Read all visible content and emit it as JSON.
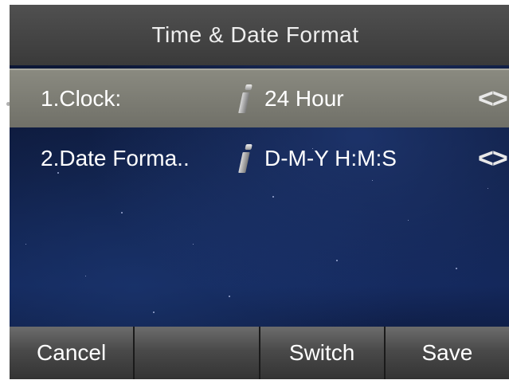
{
  "header": {
    "title": "Time & Date Format"
  },
  "rows": [
    {
      "label": "1.Clock:",
      "value": "24 Hour",
      "arrows": "<>"
    },
    {
      "label": "2.Date Forma..",
      "value": "D-M-Y H:M:S",
      "arrows": "<>"
    }
  ],
  "softkeys": {
    "cancel": "Cancel",
    "blank": "",
    "switch": "Switch",
    "save": "Save"
  },
  "colors": {
    "title_bar": "#3f3f3f",
    "selected_row": "#7c7c74",
    "background": "#0f1d42",
    "softkey": "#4a4a4a"
  },
  "icons": {
    "info": "info-icon",
    "arrows": "left-right-arrows-icon"
  }
}
